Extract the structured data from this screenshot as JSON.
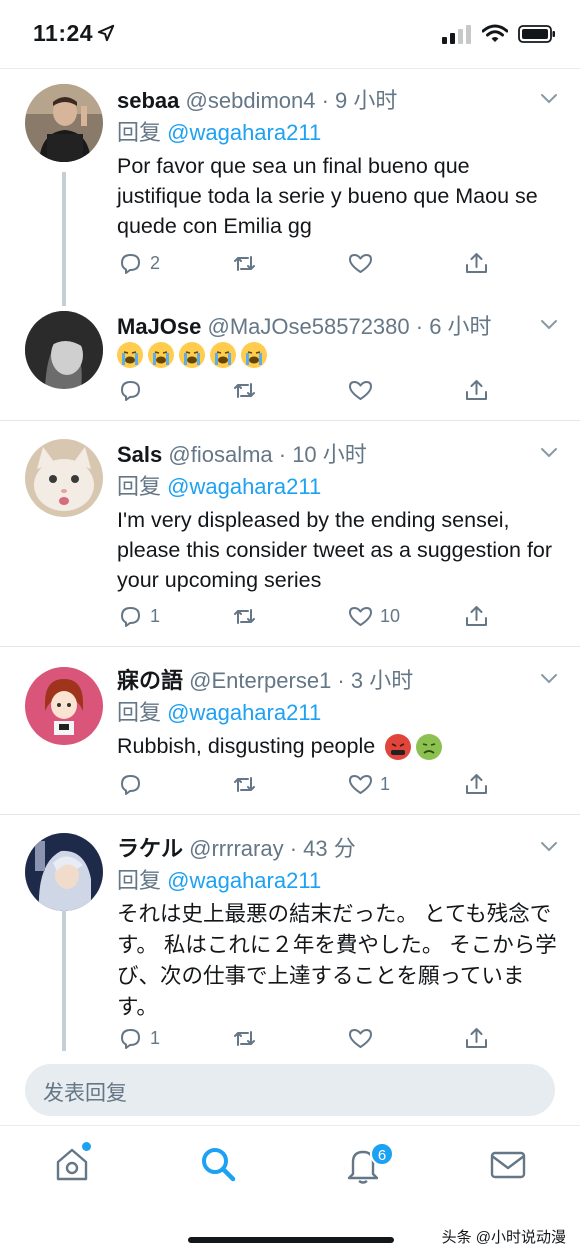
{
  "status_bar": {
    "time": "11:24"
  },
  "tweets": [
    {
      "name": "sebaa",
      "handle": "@sebdimon4 · 9 小时",
      "reply_prefix": "回复",
      "reply_to": "@wagahara211",
      "text": "Por favor que sea un final bueno que justifique toda la serie y bueno que Maou se quede con Emilia gg",
      "replies": "2",
      "retweets": "",
      "likes": ""
    },
    {
      "name": "MaJOse",
      "handle": "@MaJOse58572380 · 6 小时",
      "emojis": [
        "loudly-crying-face",
        "loudly-crying-face",
        "loudly-crying-face",
        "loudly-crying-face",
        "loudly-crying-face"
      ],
      "replies": "",
      "retweets": "",
      "likes": ""
    },
    {
      "name": "Sals",
      "handle": "@fiosalma · 10 小时",
      "reply_prefix": "回复",
      "reply_to": "@wagahara211",
      "text": "I'm very displeased by the ending sensei, please this consider tweet as a suggestion for your upcoming series",
      "replies": "1",
      "retweets": "",
      "likes": "10"
    },
    {
      "name": "寐の語",
      "handle": "@Enterperse1 · 3 小时",
      "reply_prefix": "回复",
      "reply_to": "@wagahara211",
      "text": "Rubbish, disgusting people",
      "emojis": [
        "face-with-symbols-on-mouth",
        "nauseated-face"
      ],
      "replies": "",
      "retweets": "",
      "likes": "1"
    },
    {
      "name": "ラケル",
      "handle": "@rrrraray · 43 分",
      "reply_prefix": "回复",
      "reply_to": "@wagahara211",
      "text": "それは史上最悪の結末だった。 とても残念です。 私はこれに２年を費やした。 そこから学び、次の仕事で上達することを願っています。",
      "replies": "1",
      "retweets": "",
      "likes": ""
    }
  ],
  "compose": {
    "placeholder": "发表回复"
  },
  "tabs": {
    "notifications_badge": "6"
  },
  "watermark": "头条 @小时说动漫",
  "colors": {
    "accent": "#1da1f2",
    "secondary_text": "#657786",
    "thread_line": "#c4d0d8"
  }
}
